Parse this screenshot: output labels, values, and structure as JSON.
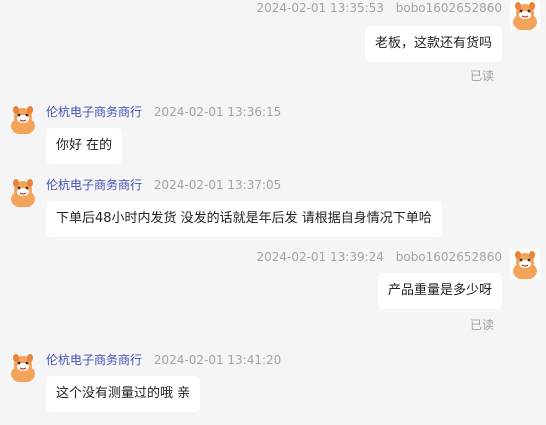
{
  "messages": [
    {
      "side": "right",
      "timestamp": "2024-02-01 13:35:53",
      "sender": "bobo1602652860",
      "text": "老板，这款还有货吗",
      "status": "已读"
    },
    {
      "side": "left",
      "sender": "伦杭电子商务商行",
      "timestamp": "2024-02-01 13:36:15",
      "text": "你好 在的"
    },
    {
      "side": "left",
      "sender": "伦杭电子商务商行",
      "timestamp": "2024-02-01 13:37:05",
      "text": "下单后48小时内发货  没发的话就是年后发 请根据自身情况下单哈"
    },
    {
      "side": "right",
      "timestamp": "2024-02-01 13:39:24",
      "sender": "bobo1602652860",
      "text": "产品重量是多少呀",
      "status": "已读"
    },
    {
      "side": "left",
      "sender": "伦杭电子商务商行",
      "timestamp": "2024-02-01 13:41:20",
      "text": "这个没有测量过的哦 亲"
    }
  ],
  "colors": {
    "background": "#f5f5f5",
    "bubble": "#ffffff",
    "seller_name": "#3f51b5",
    "meta_text": "#a3a3a3",
    "avatar_bg": "#f4a35a"
  },
  "icons": {
    "avatar": "orange-cartoon-avatar-icon"
  }
}
